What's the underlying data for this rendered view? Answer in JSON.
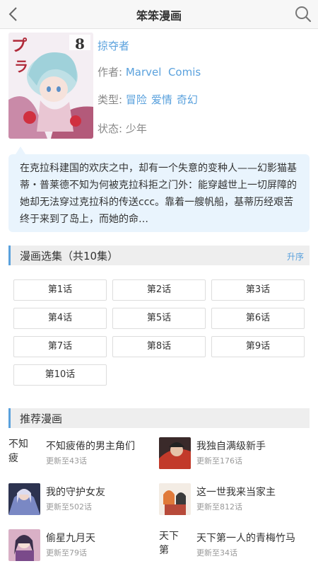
{
  "header": {
    "title": "笨笨漫画",
    "back_icon": "chevron-left-icon",
    "search_icon": "search-icon"
  },
  "manga": {
    "name": "掠夺者",
    "author_label": "作者:",
    "author": "Marvel  Comis",
    "genre_label": "类型:",
    "genres": [
      "冒险",
      "爱情",
      "奇幻"
    ],
    "status_label": "状态:",
    "status": "少年",
    "cover_volume": "8",
    "description": "在克拉科建国的欢庆之中，却有一个失意的变种人——幻影猫基蒂・普莱德不知为何被克拉科拒之门外：能穿越世上一切屏障的她却无法穿过克拉科的传送ccc。靠着一艘帆船，基蒂历经艰苦终于来到了岛上，而她的命…"
  },
  "episodes": {
    "title": "漫画选集（共10集）",
    "order_label": "升序",
    "items": [
      "第1话",
      "第2话",
      "第3话",
      "第4话",
      "第5话",
      "第6话",
      "第7话",
      "第8话",
      "第9话",
      "第10话"
    ]
  },
  "recommend": {
    "title": "推荐漫画",
    "items": [
      {
        "name": "不知疲倦的男主角们",
        "update": "更新至43话",
        "cover_alt": "不知疲"
      },
      {
        "name": "我独自满级新手",
        "update": "更新至176话"
      },
      {
        "name": "我的守护女友",
        "update": "更新至502话"
      },
      {
        "name": "这一世我来当家主",
        "update": "更新至812话"
      },
      {
        "name": "偷星九月天",
        "update": "更新至79话"
      },
      {
        "name": "天下第一人的青梅竹马",
        "update": "更新至34话",
        "cover_alt": "天下第"
      }
    ]
  },
  "colors": {
    "accent": "#5aa1dd",
    "desc_bg": "#e9f4fd",
    "section_bg": "#eeeeee"
  }
}
